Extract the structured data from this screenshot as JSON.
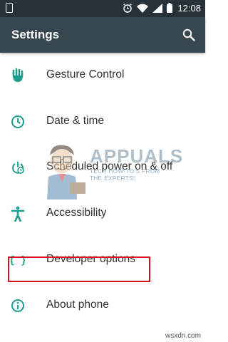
{
  "status_bar": {
    "time": "12:08",
    "icons": [
      "notification-icon",
      "alarm-icon",
      "wifi-icon",
      "signal-icon",
      "battery-icon"
    ]
  },
  "app_bar": {
    "title": "Settings",
    "search_icon": "search-icon"
  },
  "settings": {
    "items": [
      {
        "label": "Gesture Control",
        "icon": "gesture-hand-icon"
      },
      {
        "label": "Date & time",
        "icon": "clock-icon"
      },
      {
        "label": "Scheduled power on & off",
        "icon": "power-clock-icon"
      },
      {
        "label": "Accessibility",
        "icon": "accessibility-icon"
      },
      {
        "label": "Developer options",
        "icon": "developer-braces-icon"
      },
      {
        "label": "About phone",
        "icon": "info-icon"
      }
    ]
  },
  "watermark": {
    "brand": "APPUALS",
    "tagline_1": "TECH HOW-TO'S FROM",
    "tagline_2": "THE EXPERTS!"
  },
  "footer": {
    "site": "wsxdn.com"
  },
  "colors": {
    "status_bar": "#263238",
    "app_bar": "#37474f",
    "icon_teal": "#1e9e8d",
    "highlight": "#d0121b"
  }
}
